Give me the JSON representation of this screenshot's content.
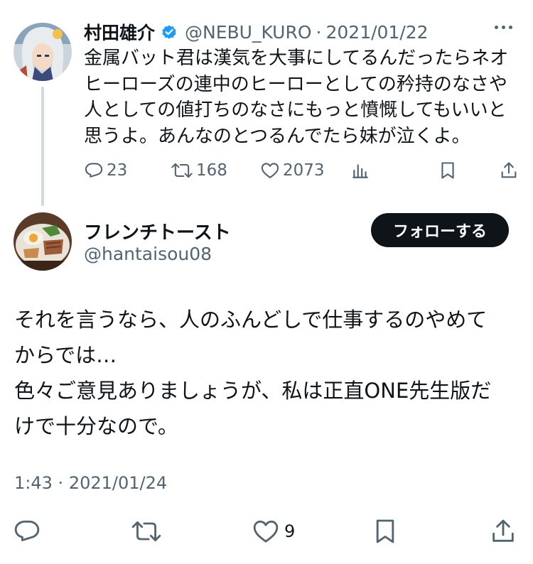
{
  "parent_tweet": {
    "author_name": "村田雄介",
    "handle": "@NEBU_KURO",
    "separator": "·",
    "date": "2021/01/22",
    "text_lines": [
      "金属バット君は漢気を大事にしてるんだったらネオ",
      "ヒーローズの連中のヒーローとしての矜持のなさや",
      "人としての値打ちのなさにもっと憤慨してもいいと",
      "思うよ。あんなのとつるんでたら妹が泣くよ。"
    ],
    "actions": {
      "replies": "23",
      "retweets": "168",
      "likes": "2073"
    }
  },
  "reply_tweet": {
    "author_name": "フレンチトースト",
    "handle": "@hantaisou08",
    "follow_label": "フォローする",
    "text_lines": [
      "それを言うなら、人のふんどしで仕事するのやめて",
      "からでは…",
      "色々ご意見ありましょうが、私は正直ONE先生版だ",
      "けで十分なので。"
    ],
    "time": "1:43",
    "separator": "·",
    "date": "2021/01/24",
    "actions": {
      "likes": "9"
    }
  },
  "colors": {
    "text_primary": "#0f1419",
    "text_secondary": "#536471",
    "verified_blue": "#1d9bf0",
    "thread_line": "#cfd9de",
    "follow_button_bg": "#0f1419"
  }
}
